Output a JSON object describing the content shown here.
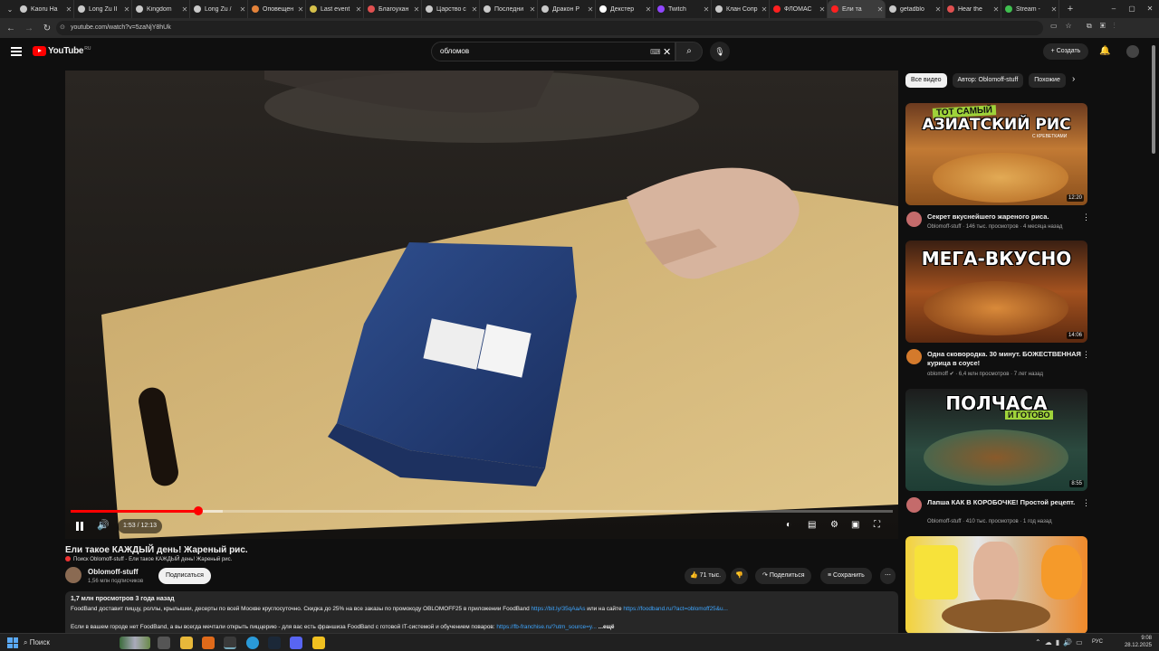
{
  "browser": {
    "tabs": [
      {
        "label": "Kaoru Ha",
        "color": "#c9c9c9"
      },
      {
        "label": "Long Zu II",
        "color": "#c9c9c9"
      },
      {
        "label": "Kingdom",
        "color": "#c9c9c9"
      },
      {
        "label": "Long Zu /",
        "color": "#c9c9c9"
      },
      {
        "label": "Оповещен",
        "color": "#e3823a"
      },
      {
        "label": "Last event",
        "color": "#d5c04a"
      },
      {
        "label": "Благоухан",
        "color": "#e05050"
      },
      {
        "label": "Царство с",
        "color": "#c9c9c9"
      },
      {
        "label": "Последни",
        "color": "#c9c9c9"
      },
      {
        "label": "Дракон Р",
        "color": "#c9c9c9"
      },
      {
        "label": "Декстер",
        "color": "#ffffff"
      },
      {
        "label": "Twitch",
        "color": "#9146ff"
      },
      {
        "label": "Клан Сопр",
        "color": "#c9c9c9"
      },
      {
        "label": "ФЛОМАС",
        "color": "#ff2020"
      },
      {
        "label": "Ели та",
        "color": "#ff2020",
        "active": true
      },
      {
        "label": "getadblo",
        "color": "#c9c9c9"
      },
      {
        "label": "Hear the",
        "color": "#e05050"
      },
      {
        "label": "Stream -",
        "color": "#3fbf4f"
      }
    ],
    "url": "youtube.com/watch?v=5zaNjY8hUk"
  },
  "header": {
    "logo_text": "YouTube",
    "region": "RU",
    "search_value": "обломов",
    "create_label": "Создать"
  },
  "player": {
    "time_display": "1:53 / 12:13",
    "progress_fraction": 0.155,
    "buffer_fraction": 0.185
  },
  "video": {
    "title": "Ели такое КАЖДЫЙ день! Жареный рис.",
    "search_hint": "Поиск Oblomoff-stuff - Ели такое КАЖДЫЙ день! Жареный рис.",
    "channel": "Oblomoff-stuff",
    "subscribers": "1,56 млн подписчиков",
    "subscribe_label": "Подписаться",
    "likes": "71 тыс.",
    "share_label": "Поделиться",
    "save_label": "Сохранить",
    "description": {
      "stats": "1,7 млн просмотров  3 года назад",
      "line1_text": "FoodBand доставит пиццу, роллы, крылышки, десерты по всей Москве круглосуточно. Скидка до 25% на все заказы по промокоду OBLOMOFF25 в приложении FoodBand ",
      "line1_link1": "https://bit.ly/35qAaAs",
      "line1_mid": " или на сайте ",
      "line1_link2": "https://foodband.ru/?act=oblomoff25&u...",
      "line2_text": "Если в вашем городе нет FoodBand, а вы всегда мечтали открыть пиццерию - для вас есть франшиза FoodBand с готовой IT-системой и обучением поваров: ",
      "line2_link": "https://fb-franchise.ru/?utm_source=y...",
      "more": "...ещё"
    }
  },
  "sidebar": {
    "chips": [
      "Все видео",
      "Автор: Oblomoff-stuff",
      "Похожие"
    ],
    "videos": [
      {
        "thumb_top": "ТОТ САМЫЙ",
        "thumb_main": "АЗИАТСКИЙ РИС",
        "thumb_sub": "С КРЕВЕТКАМИ",
        "duration": "12:20",
        "title": "Секрет вкуснейшего жареного риса.",
        "meta": "Oblomoff-stuff · 146 тыс. просмотров · 4 месяца назад"
      },
      {
        "thumb_main": "МЕГА-ВКУСНО",
        "duration": "14:06",
        "title": "Одна сковородка. 30 минут. БОЖЕСТВЕННАЯ курица в соусе!",
        "meta": "oblomoff ✔ · 6,4 млн просмотров · 7 лет назад"
      },
      {
        "thumb_main": "ПОЛЧАСА",
        "thumb_sub": "И ГОТОВО",
        "duration": "8:55",
        "title": "Лапша КАК В КОРОБОЧКЕ! Простой рецепт.",
        "meta": "Oblomoff-stuff · 410 тыс. просмотров · 1 год назад"
      }
    ]
  },
  "taskbar": {
    "search_label": "Поиск",
    "lang": "РУС",
    "time": "9:08",
    "date": "28.12.2025"
  }
}
